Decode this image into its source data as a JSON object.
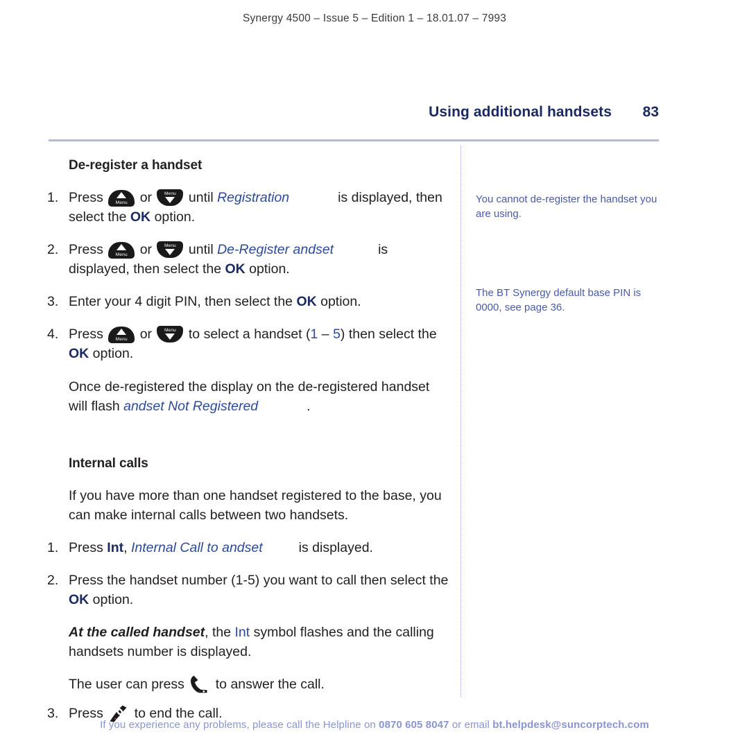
{
  "header": {
    "running_head": "Synergy 4500 – Issue 5 –  Edition 1 – 18.01.07 – 7993"
  },
  "title_row": {
    "title": "Using additional handsets",
    "page_number": "83"
  },
  "sections": [
    {
      "heading": "De-register a handset",
      "steps": [
        {
          "num": "1.",
          "p1": "Press",
          "or": "or",
          "p2": "until",
          "display_text": "Registration",
          "p3": "is displayed, then select the",
          "ok": "OK",
          "p4": "option."
        },
        {
          "num": "2.",
          "p1": "Press",
          "or": "or",
          "p2": "until",
          "display_text": "De-Register andset",
          "p3": "is displayed, then select the",
          "ok": "OK",
          "p4": "option."
        },
        {
          "num": "3.",
          "p1": "Enter your 4 digit PIN, then select the",
          "ok": "OK",
          "p4": "option."
        },
        {
          "num": "4.",
          "p1": "Press",
          "or": "or",
          "p2": "to select a handset (",
          "range_from": "1",
          "range_dash": "–",
          "range_to": "5",
          "p3": ") then select the",
          "ok": "OK",
          "p4": "option."
        }
      ],
      "paragraph": {
        "p1": "Once de-registered the display on the de-registered handset will flash",
        "display_text": "andset Not Registered",
        "p2": "."
      }
    },
    {
      "heading": "Internal calls",
      "intro": "If you have more than one handset registered to the base, you can make internal calls between two handsets.",
      "steps": [
        {
          "num": "1.",
          "p1": "Press",
          "int": "Int",
          "comma": ",",
          "display_text": "Internal Call to andset",
          "p3": "is displayed."
        },
        {
          "num": "2.",
          "p1": "Press the handset number (1-5) you want to call then select the",
          "ok": "OK",
          "p4": "option."
        }
      ],
      "called_paragraph": {
        "bold_italic": "At the called handset",
        "p1": ", the",
        "int": "Int",
        "p2": "symbol flashes and the calling handsets number is displayed."
      },
      "answer_paragraph": {
        "p1": "The user can press",
        "p2": "to answer the call."
      },
      "end_step": {
        "num": "3.",
        "p1": "Press",
        "p2": "to end the call."
      }
    }
  ],
  "side_notes": [
    "You cannot de-register the handset you are using.",
    "The BT Synergy default base PIN is 0000, see page 36."
  ],
  "footer": {
    "text_before": "If you experience any problems, please call the Helpline on ",
    "phone": "0870 605 8047",
    "text_middle": " or email ",
    "email": "bt.helpdesk@suncorptech.com"
  },
  "icons": {
    "menu_up_label": "Menu",
    "menu_down_label": "Menu",
    "answer_call": "phone-offhook-icon",
    "end_call": "phone-onhook-icon"
  },
  "colors": {
    "title_navy": "#1b2a63",
    "display_blue": "#2b4a9b",
    "side_note_blue": "#4a5aa8",
    "footer_blue": "#8b95cf",
    "rule_lavender": "#b3b9dd",
    "body_black": "#231f20"
  }
}
